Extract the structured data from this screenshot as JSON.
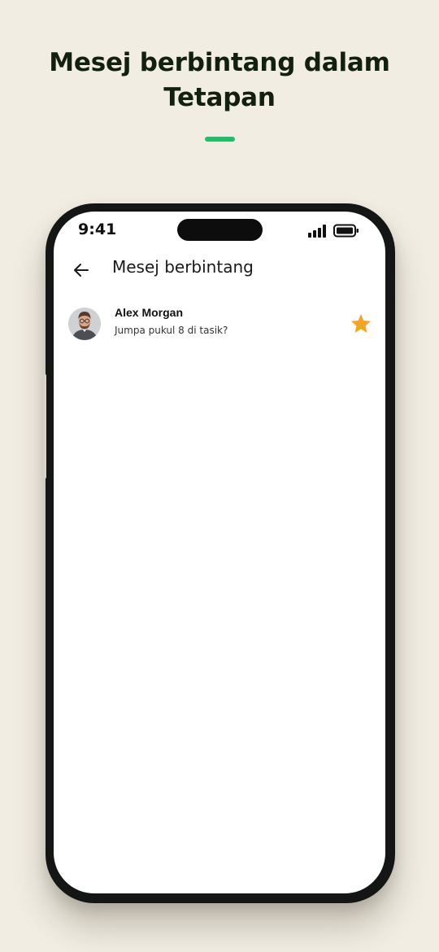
{
  "headline": {
    "line1": "Mesej berbintang dalam",
    "line2": "Tetapan"
  },
  "colors": {
    "background": "#f1ede3",
    "accent": "#1fbe68",
    "star": "#f2a523",
    "phone_frame": "#141515"
  },
  "status_bar": {
    "time": "9:41",
    "signal_icon": "cellular-signal-icon",
    "battery_icon": "battery-full-icon"
  },
  "app_bar": {
    "back_icon": "arrow-left-icon",
    "title": "Mesej berbintang"
  },
  "starred_messages": [
    {
      "contact_name": "Alex Morgan",
      "message": "Jumpa pukul 8 di tasik?",
      "avatar": "profile-photo",
      "starred": true,
      "star_icon": "star-filled-icon"
    }
  ]
}
